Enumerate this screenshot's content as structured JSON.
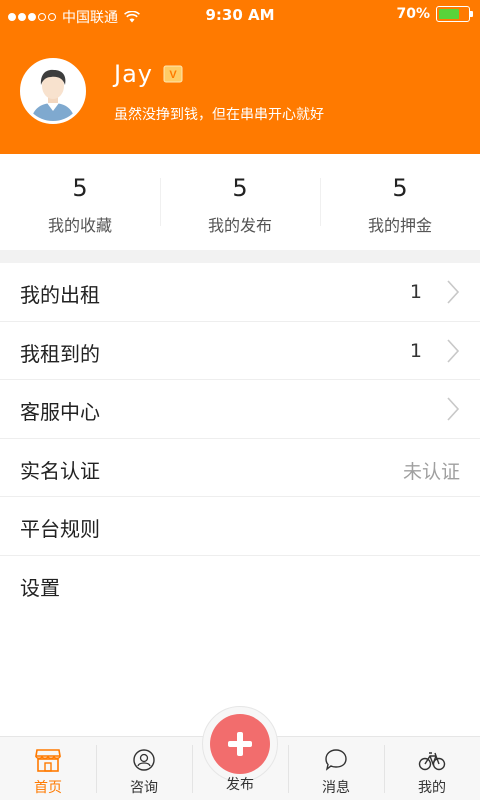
{
  "status_bar": {
    "carrier": "中国联通",
    "time": "9:30 AM",
    "battery": "70%",
    "battery_level": 0.7
  },
  "profile": {
    "username": "Jay",
    "vip_badge_icon": "vip-badge-icon",
    "tagline": "虽然没挣到钱，但在串串开心就好",
    "avatar_icon": "user-avatar"
  },
  "stats": [
    {
      "value": "5",
      "label": "我的收藏"
    },
    {
      "value": "5",
      "label": "我的发布"
    },
    {
      "value": "5",
      "label": "我的押金"
    }
  ],
  "menu": [
    {
      "label": "我的出租",
      "value": "1",
      "chevron": true
    },
    {
      "label": "我租到的",
      "value": "1",
      "chevron": true
    },
    {
      "label": "客服中心",
      "value": "",
      "chevron": true
    },
    {
      "label": "实名认证",
      "value": "未认证",
      "chevron": false
    },
    {
      "label": "平台规则",
      "value": "",
      "chevron": false
    },
    {
      "label": "设置",
      "value": "",
      "chevron": false
    }
  ],
  "tabbar": {
    "home": "首页",
    "consult": "咨询",
    "publish": "发布",
    "messages": "消息",
    "mine": "我的",
    "active_color": "#ff7a00",
    "publish_color": "#f26d6d"
  },
  "colors": {
    "brand": "#ff7a00",
    "battery_fill": "#59d33a"
  }
}
